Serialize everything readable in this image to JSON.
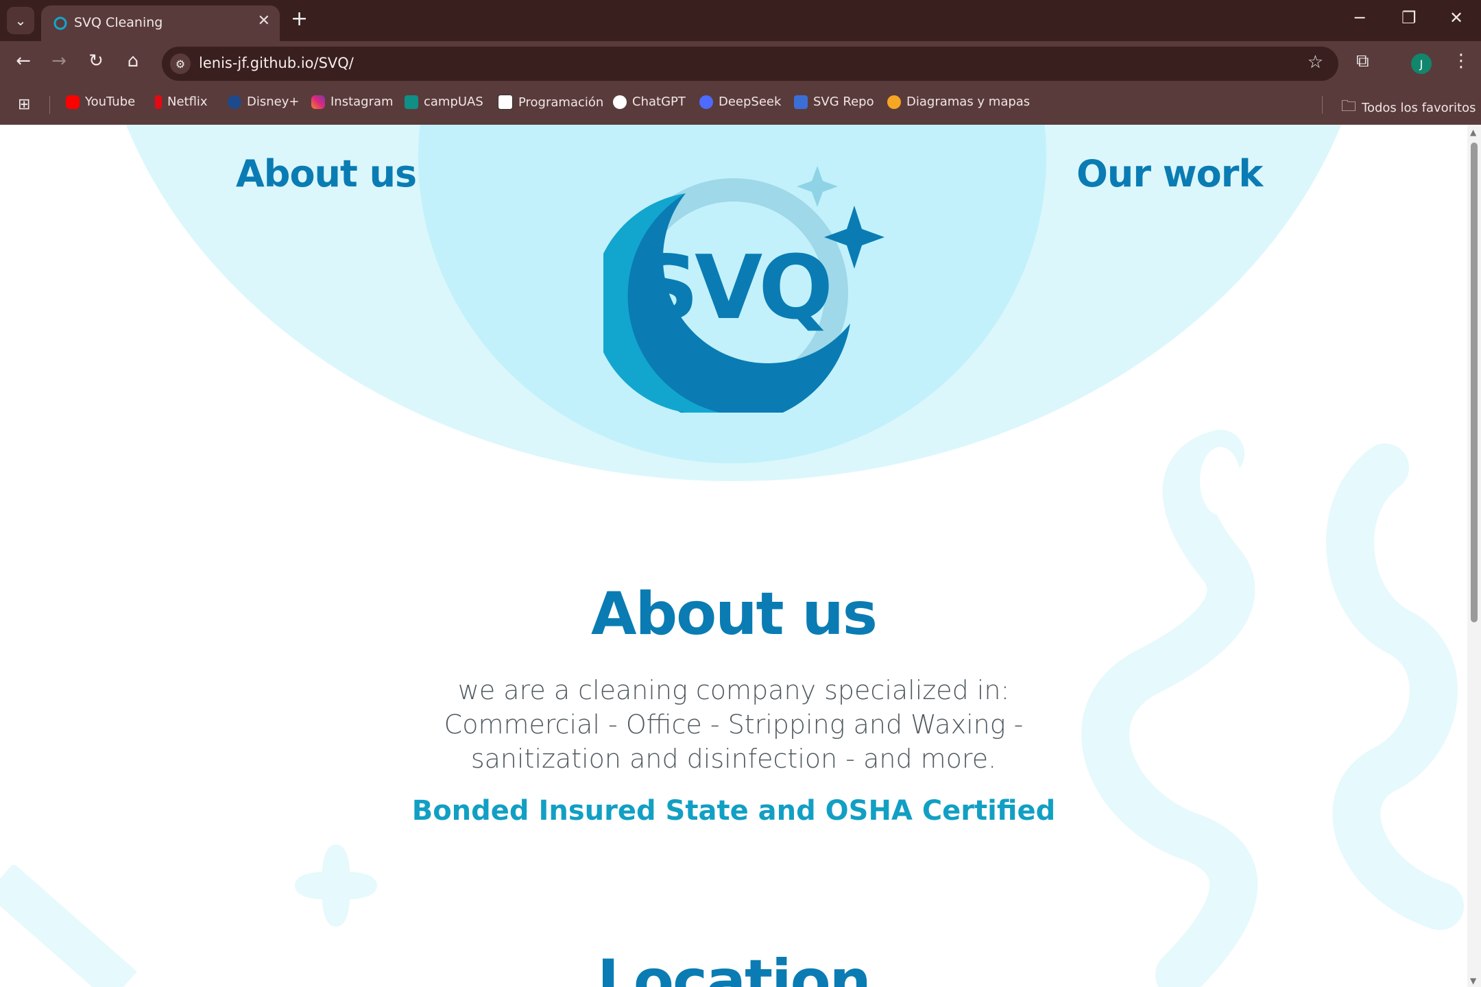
{
  "browser": {
    "tab_title": "SVQ Cleaning",
    "url": "lenis-jf.github.io/SVQ/",
    "avatar_letter": "J",
    "bookmarks": [
      {
        "label": "YouTube",
        "color": "#ff0000"
      },
      {
        "label": "Netflix",
        "color": "#e50914"
      },
      {
        "label": "Disney+",
        "color": "#1d4a8c"
      },
      {
        "label": "Instagram",
        "color": "#d62976"
      },
      {
        "label": "campUAS",
        "color": "#0f8f86"
      },
      {
        "label": "Programación",
        "color": "#ffffff"
      },
      {
        "label": "ChatGPT",
        "color": "#ffffff"
      },
      {
        "label": "DeepSeek",
        "color": "#4d6bfe"
      },
      {
        "label": "SVG Repo",
        "color": "#3b6fd6"
      },
      {
        "label": "Diagramas y mapas",
        "color": "#f5a623"
      }
    ],
    "all_bookmarks_label": "Todos los favoritos"
  },
  "page": {
    "nav": {
      "about_label": "About us",
      "work_label": "Our work"
    },
    "logo_text": "SVQ",
    "about": {
      "title": "About us",
      "line1": "we are a cleaning company specialized in:",
      "line2": "Commercial - Office - Stripping and Waxing -",
      "line3": "sanitization and disinfection - and more.",
      "certified": "Bonded Insured State and OSHA Certified"
    },
    "location_title": "Location",
    "colors": {
      "primary": "#0a7cb3",
      "accent": "#129fc4",
      "hero_light": "#dbf7fc",
      "hero_inner": "#c2f1fb",
      "chrome": "#3a1f1f"
    }
  }
}
